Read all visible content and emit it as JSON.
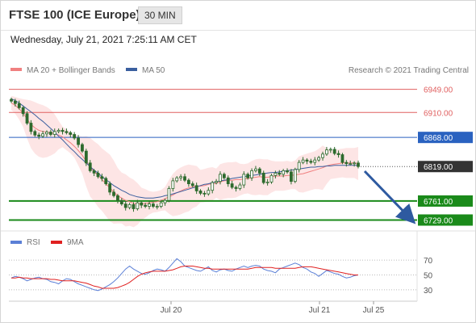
{
  "header": {
    "instrument": "FTSE 100 (ICE Europe)",
    "timeframe": "30 MIN",
    "datetime": "Wednesday, July 21, 2021 7:25:11 AM CET"
  },
  "legend": {
    "bollinger": "MA 20 + Bollinger Bands",
    "ma50": "MA 50",
    "copyright": "Research © 2021 Trading Central",
    "rsi": "RSI",
    "rsi_ma": "9MA"
  },
  "colors": {
    "bollinger": "#f08080",
    "ma50": "#3a5f9f",
    "resistance": "#e06060",
    "pivot": "#2a62c0",
    "support": "#1a8a1a",
    "current": "#333333",
    "arrow": "#2e5aa0",
    "candle": "#2d6a2d"
  },
  "chart_data": [
    {
      "type": "candlestick",
      "title": "FTSE 100 (ICE Europe)",
      "timeframe": "30 MIN",
      "x_ticks": [
        "Jul 20",
        "Jul 21",
        "Jul 25"
      ],
      "ylim": [
        6712,
        6962
      ],
      "current_price": 6819.0,
      "levels": [
        {
          "value": 6949.0,
          "label": "6949.00",
          "kind": "resistance"
        },
        {
          "value": 6910.0,
          "label": "6910.00",
          "kind": "resistance"
        },
        {
          "value": 6868.0,
          "label": "6868.00",
          "kind": "pivot"
        },
        {
          "value": 6761.0,
          "label": "6761.00",
          "kind": "support"
        },
        {
          "value": 6729.0,
          "label": "6729.00",
          "kind": "support"
        }
      ],
      "close": [
        6929,
        6925,
        6918,
        6908,
        6892,
        6878,
        6872,
        6870,
        6874,
        6877,
        6873,
        6878,
        6880,
        6878,
        6876,
        6873,
        6867,
        6856,
        6845,
        6825,
        6812,
        6808,
        6802,
        6799,
        6790,
        6776,
        6770,
        6762,
        6756,
        6750,
        6755,
        6748,
        6758,
        6754,
        6752,
        6756,
        6752,
        6752,
        6758,
        6762,
        6782,
        6795,
        6800,
        6802,
        6796,
        6790,
        6787,
        6778,
        6774,
        6773,
        6779,
        6792,
        6794,
        6806,
        6800,
        6790,
        6784,
        6782,
        6788,
        6806,
        6800,
        6812,
        6815,
        6808,
        6792,
        6793,
        6804,
        6808,
        6806,
        6812,
        6810,
        6794,
        6814,
        6826,
        6830,
        6828,
        6826,
        6830,
        6834,
        6840,
        6847,
        6848,
        6841,
        6839,
        6826,
        6824,
        6824,
        6825,
        6819
      ],
      "ma20": [
        6926,
        6922,
        6916,
        6909,
        6899,
        6890,
        6884,
        6880,
        6878,
        6877,
        6876,
        6874,
        6872,
        6869,
        6864,
        6859,
        6853,
        6846,
        6838,
        6828,
        6818,
        6811,
        6804,
        6797,
        6790,
        6783,
        6776,
        6770,
        6766,
        6762,
        6760,
        6757,
        6756,
        6756,
        6757,
        6758,
        6759,
        6760,
        6762,
        6765,
        6768,
        6771,
        6775,
        6778,
        6781,
        6783,
        6785,
        6786,
        6786,
        6787,
        6789,
        6790,
        6791,
        6793,
        6795,
        6796,
        6796,
        6797,
        6797,
        6798,
        6799,
        6800,
        6801,
        6802,
        6801,
        6801,
        6802,
        6803,
        6803,
        6803,
        6804,
        6804,
        6805,
        6806,
        6807,
        6809,
        6811,
        6813,
        6815,
        6817,
        6820,
        6822,
        6823,
        6824,
        6825,
        6825,
        6825,
        6825,
        6824
      ],
      "ma50": [
        6933,
        6930,
        6926,
        6921,
        6916,
        6911,
        6906,
        6900,
        6895,
        6889,
        6883,
        6877,
        6870,
        6864,
        6857,
        6850,
        6844,
        6837,
        6831,
        6825,
        6819,
        6813,
        6808,
        6802,
        6797,
        6792,
        6787,
        6783,
        6779,
        6776,
        6772,
        6770,
        6768,
        6767,
        6766,
        6766,
        6766,
        6767,
        6768,
        6770,
        6771,
        6773,
        6775,
        6777,
        6779,
        6781,
        6783,
        6785,
        6787,
        6789,
        6790,
        6792,
        6793,
        6795,
        6796,
        6797,
        6799,
        6800,
        6801,
        6802,
        6803,
        6804,
        6805,
        6806,
        6807,
        6808,
        6809,
        6809,
        6810,
        6811,
        6812,
        6813,
        6814,
        6815,
        6816,
        6817,
        6818,
        6818,
        6819,
        6819,
        6820,
        6820,
        6821,
        6821,
        6821,
        6821,
        6821,
        6821,
        6821
      ]
    },
    {
      "type": "line",
      "title": "RSI",
      "ylim": [
        20,
        80
      ],
      "y_ticks": [
        70,
        50,
        30
      ],
      "series": [
        {
          "name": "RSI",
          "values": [
            46,
            48,
            47,
            45,
            42,
            44,
            46,
            47,
            45,
            44,
            41,
            40,
            38,
            42,
            45,
            44,
            41,
            38,
            36,
            34,
            32,
            30,
            29,
            31,
            34,
            37,
            41,
            46,
            52,
            58,
            62,
            58,
            55,
            52,
            51,
            53,
            56,
            58,
            57,
            55,
            60,
            66,
            72,
            68,
            62,
            60,
            58,
            56,
            55,
            58,
            61,
            56,
            54,
            57,
            58,
            56,
            55,
            58,
            60,
            62,
            60,
            62,
            63,
            62,
            58,
            56,
            55,
            53,
            58,
            60,
            62,
            64,
            66,
            64,
            60,
            58,
            54,
            52,
            48,
            52,
            56,
            54,
            52,
            51,
            48,
            46,
            47,
            49,
            50
          ]
        },
        {
          "name": "9MA",
          "values": [
            46,
            46,
            47,
            46,
            46,
            45,
            45,
            45,
            45,
            45,
            44,
            44,
            43,
            42,
            42,
            42,
            42,
            41,
            40,
            39,
            37,
            35,
            34,
            32,
            32,
            32,
            32,
            33,
            35,
            37,
            40,
            44,
            48,
            51,
            53,
            54,
            55,
            55,
            55,
            55,
            56,
            57,
            59,
            61,
            62,
            62,
            62,
            61,
            60,
            59,
            59,
            58,
            58,
            58,
            58,
            58,
            58,
            58,
            58,
            58,
            58,
            59,
            60,
            60,
            60,
            60,
            60,
            59,
            59,
            59,
            59,
            59,
            59,
            60,
            61,
            61,
            61,
            60,
            59,
            58,
            57,
            56,
            55,
            54,
            53,
            52,
            51,
            50,
            50
          ]
        }
      ]
    }
  ]
}
